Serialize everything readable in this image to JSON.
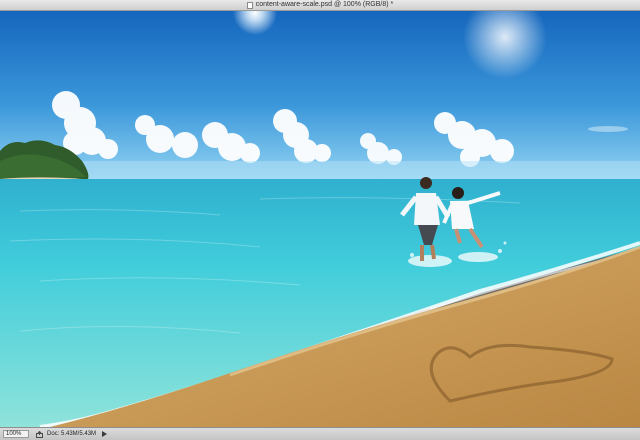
{
  "window": {
    "title": "content-aware-scale.psd @ 100% (RGB/8) *"
  },
  "status_bar": {
    "zoom": "100%",
    "doc_info": "Doc: 5.43M/5.43M"
  },
  "icons": {
    "document": "document-icon",
    "share": "share-icon",
    "status_menu": "triangle-right-icon"
  },
  "colors": {
    "sky_top": "#1d76c8",
    "sky_horizon": "#8fd2f2",
    "sea": "#3fc8d8",
    "sand": "#c99a55"
  }
}
